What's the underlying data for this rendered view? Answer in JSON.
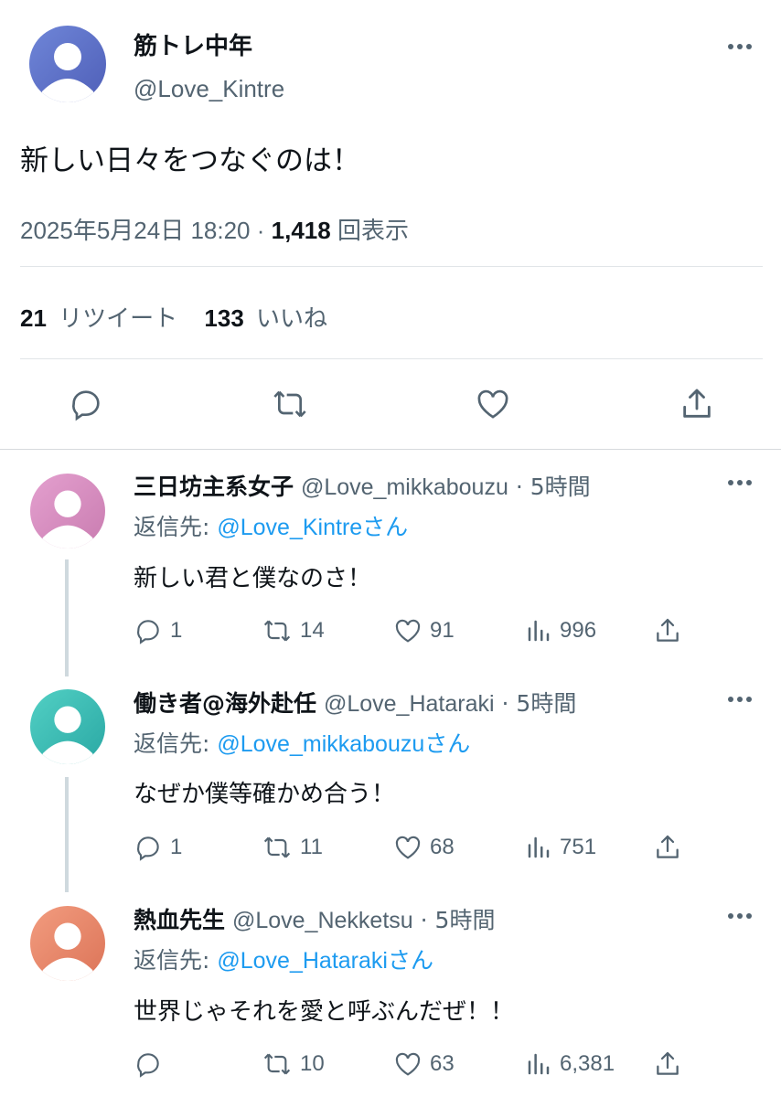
{
  "main_tweet": {
    "display_name": "筋トレ中年",
    "handle": "@Love_Kintre",
    "text": "新しい日々をつなぐのは！",
    "timestamp": "2025年5月24日 18:20",
    "separator": "·",
    "views_count": "1,418",
    "views_label": "回表示",
    "retweets_count": "21",
    "retweets_label": "リツイート",
    "likes_count": "133",
    "likes_label": "いいね",
    "avatar_color": "#5b6fc4"
  },
  "replies": [
    {
      "display_name": "三日坊主系女子",
      "handle": "@Love_mikkabouzu",
      "time": "· 5時間",
      "reply_prefix": "返信先: ",
      "reply_to": "@Love_Kintreさん",
      "text": "新しい君と僕なのさ！",
      "replies": "1",
      "retweets": "14",
      "likes": "91",
      "views": "996",
      "avatar_color": "#d98bc0"
    },
    {
      "display_name": "働き者@海外赴任",
      "handle": "@Love_Hataraki",
      "time": "· 5時間",
      "reply_prefix": "返信先: ",
      "reply_to": "@Love_mikkabouzuさん",
      "text": "なぜか僕等確かめ合う！",
      "replies": "1",
      "retweets": "11",
      "likes": "68",
      "views": "751",
      "avatar_color": "#3bbfb4"
    },
    {
      "display_name": "熱血先生",
      "handle": "@Love_Nekketsu",
      "time": "· 5時間",
      "reply_prefix": "返信先: ",
      "reply_to": "@Love_Hatarakiさん",
      "text": "世界じゃそれを愛と呼ぶんだぜ！！",
      "replies": "",
      "retweets": "10",
      "likes": "63",
      "views": "6,381",
      "avatar_color": "#e8876a"
    }
  ],
  "colors": {
    "accent": "#1d9bf0",
    "secondary_text": "#536471",
    "divider": "#e1e5e8"
  },
  "icons": [
    "reply-icon",
    "retweet-icon",
    "like-icon",
    "share-icon",
    "views-icon",
    "more-icon"
  ]
}
